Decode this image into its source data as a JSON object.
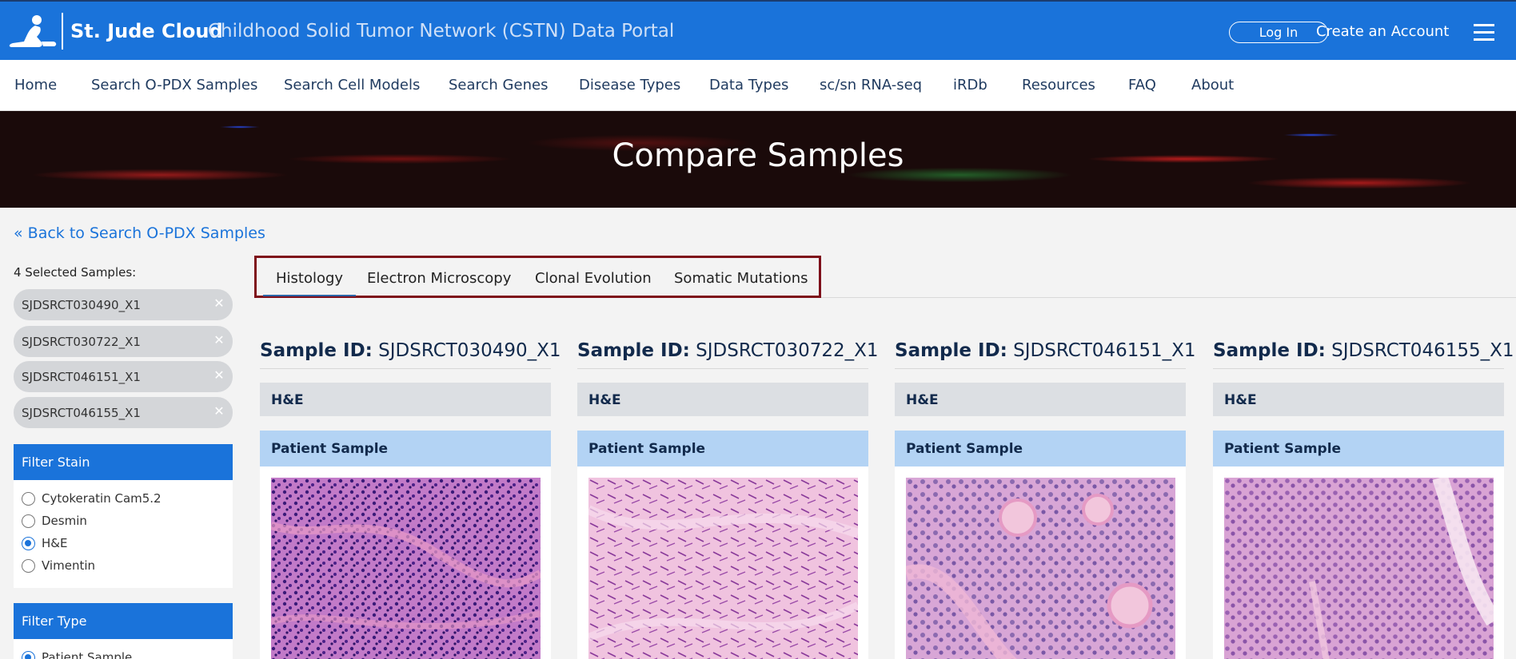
{
  "header": {
    "brand": "St. Jude Cloud",
    "portal_title": "Childhood Solid Tumor Network (CSTN) Data Portal",
    "login_label": "Log In",
    "create_account_label": "Create an Account"
  },
  "nav": {
    "items": [
      "Home",
      "Search O-PDX Samples",
      "Search Cell Models",
      "Search Genes",
      "Disease Types",
      "Data Types",
      "sc/sn RNA-seq",
      "iRDb",
      "Resources",
      "FAQ",
      "About"
    ]
  },
  "banner": {
    "title": "Compare Samples"
  },
  "back_link": "« Back to Search O-PDX Samples",
  "sidebar": {
    "selected_label": "4 Selected Samples:",
    "chips": [
      "SJDSRCT030490_X1",
      "SJDSRCT030722_X1",
      "SJDSRCT046151_X1",
      "SJDSRCT046155_X1"
    ],
    "filter_stain": {
      "title": "Filter Stain",
      "options": [
        "Cytokeratin Cam5.2",
        "Desmin",
        "H&E",
        "Vimentin"
      ],
      "selected": "H&E"
    },
    "filter_type": {
      "title": "Filter Type",
      "options": [
        "Patient Sample"
      ],
      "selected": "Patient Sample"
    }
  },
  "tabs": {
    "items": [
      "Histology",
      "Electron Microscopy",
      "Clonal Evolution",
      "Somatic Mutations"
    ],
    "active": "Histology",
    "highlight_color": "#7e0f1a"
  },
  "samples": [
    {
      "id_label": "Sample ID:",
      "id": "SJDSRCT030490_X1",
      "stain": "H&E",
      "card_title": "Patient Sample"
    },
    {
      "id_label": "Sample ID:",
      "id": "SJDSRCT030722_X1",
      "stain": "H&E",
      "card_title": "Patient Sample"
    },
    {
      "id_label": "Sample ID:",
      "id": "SJDSRCT046151_X1",
      "stain": "H&E",
      "card_title": "Patient Sample"
    },
    {
      "id_label": "Sample ID:",
      "id": "SJDSRCT046155_X1",
      "stain": "H&E",
      "card_title": "Patient Sample"
    }
  ],
  "colors": {
    "header_blue": "#1a73da",
    "nav_text": "#1f3a5f",
    "card_head": "#b3d3f4",
    "stain_bar": "#dcdfe3"
  },
  "icons": {
    "logo": "st-jude-child-logo-icon",
    "menu": "hamburger-menu-icon",
    "chip_remove": "close-icon"
  }
}
